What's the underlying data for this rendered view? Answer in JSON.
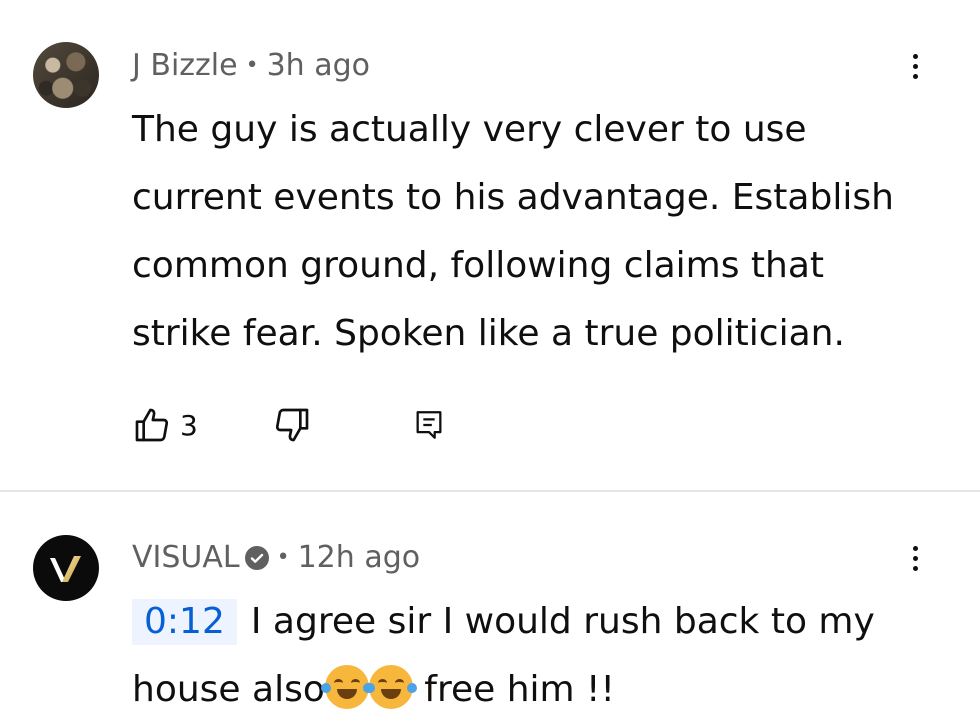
{
  "comments": [
    {
      "author": "J Bizzle",
      "separator": "•",
      "time": "3h ago",
      "lines": [
        "The guy is actually very clever to use",
        "current events to his advantage. Establish",
        "common ground, following claims that",
        "strike fear. Spoken like a true politician."
      ],
      "like_count": "3"
    },
    {
      "author": "VISUAL",
      "separator": "•",
      "time": "12h ago",
      "timestamp_link": "0:12",
      "line1": "I agree sir I would rush back to my",
      "line2_start": "house also",
      "line2_end": " free him !!"
    }
  ],
  "icons": {
    "like": "thumbs-up-icon",
    "dislike": "thumbs-down-icon",
    "reply": "reply-icon",
    "more": "more-vertical-icon",
    "verified": "verified-check-icon",
    "emoji": "face-with-tears-of-joy"
  },
  "colors": {
    "meta": "#606060",
    "link": "#065fd4",
    "link_bg": "#eef4ff",
    "divider": "#e5e5e5"
  }
}
